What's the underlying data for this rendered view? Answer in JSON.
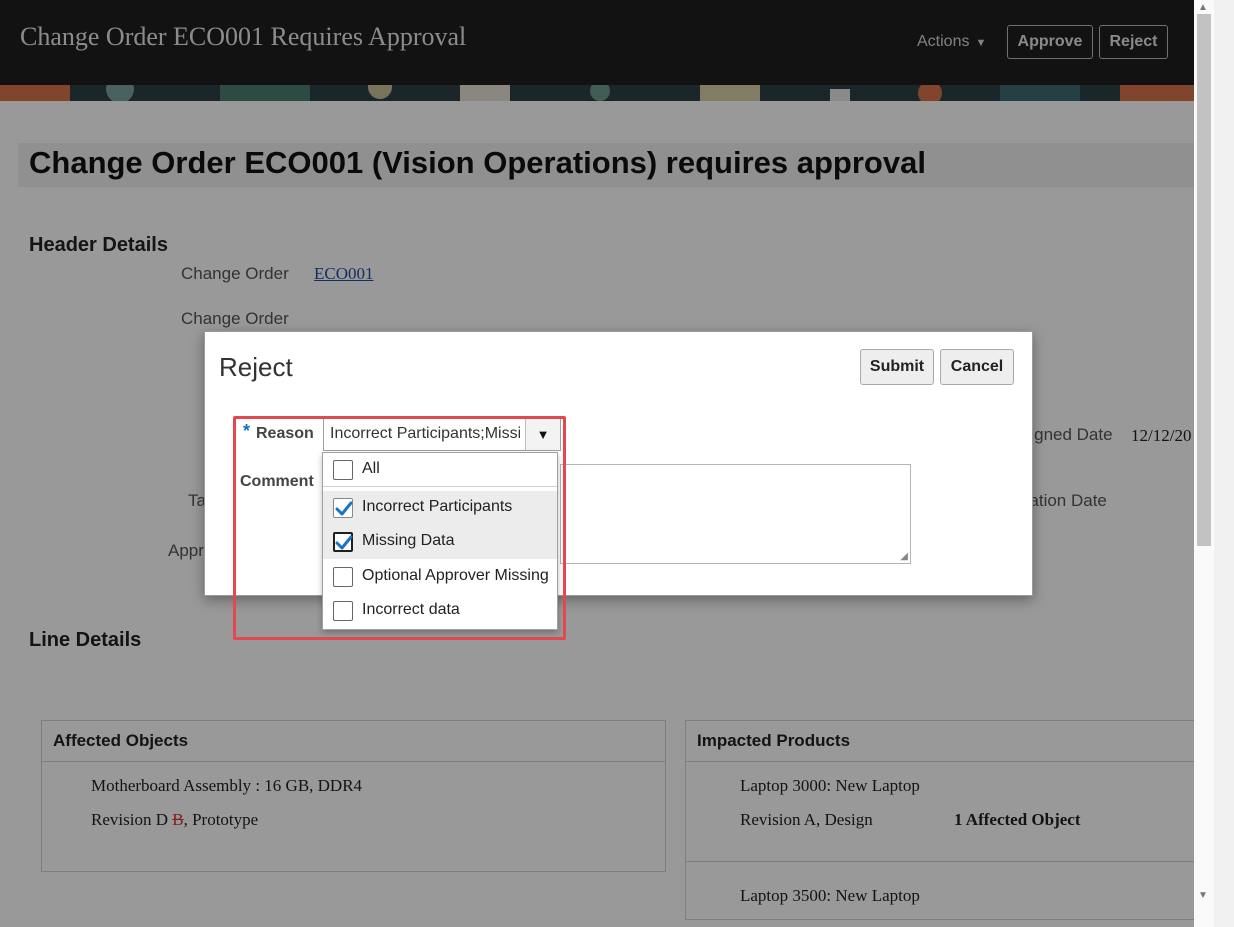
{
  "app": {
    "title": "Change Order ECO001 Requires Approval",
    "actions_label": "Actions",
    "approve_label": "Approve",
    "reject_label": "Reject"
  },
  "page": {
    "heading": "Change Order ECO001 (Vision Operations) requires approval",
    "header_details": {
      "section_title": "Header Details",
      "change_order_label": "Change Order",
      "change_order_link": "ECO001",
      "change_order_label_2": "Change Order",
      "assigned_date_label": "Assigned Date",
      "assigned_date_value": "12/12/20",
      "creation_date_label": "Creation Date",
      "task_label_fragment": "Ta",
      "approval_label_fragment": "Appr"
    },
    "line_details": {
      "section_title": "Line Details",
      "affected_objects": {
        "title": "Affected Objects",
        "item_name": "Motherboard Assembly : 16 GB, DDR4",
        "revision_new": "Revision D",
        "revision_old": "B",
        "revision_suffix": ", Prototype"
      },
      "impacted_products": {
        "title": "Impacted Products",
        "item1_name": "Laptop 3000: New Laptop",
        "item1_revision": "Revision A, Design",
        "item1_count": "1 Affected Object",
        "item2_name": "Laptop 3500: New Laptop"
      }
    }
  },
  "dialog": {
    "title": "Reject",
    "submit_label": "Submit",
    "cancel_label": "Cancel",
    "reason_required_mark": "*",
    "reason_label": "Reason",
    "reason_value": "Incorrect Participants;Missing Data",
    "comment_label": "Comment",
    "comment_value": "",
    "reason_options": [
      {
        "label": "All",
        "checked": false
      },
      {
        "label": "Incorrect Participants",
        "checked": true
      },
      {
        "label": "Missing Data",
        "checked": true
      },
      {
        "label": "Optional Approver Missing",
        "checked": false
      },
      {
        "label": "Incorrect data",
        "checked": false
      }
    ]
  },
  "colors": {
    "highlight": "#e3474f",
    "check": "#1a73c9",
    "link": "#1f4e9c"
  }
}
